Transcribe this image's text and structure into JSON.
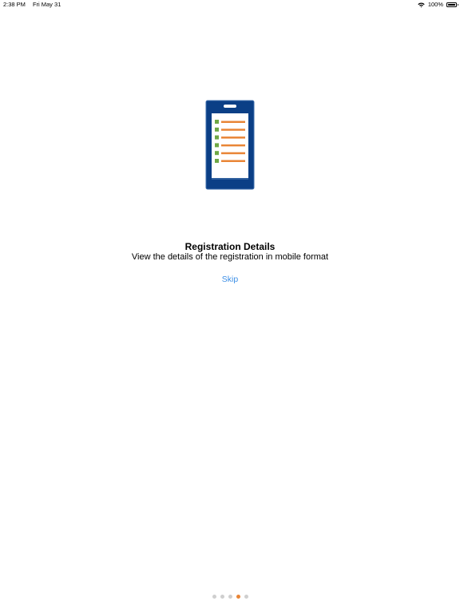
{
  "status_bar": {
    "time": "2:38 PM",
    "date": "Fri May 31",
    "battery_percent": "100%",
    "icons": [
      "wifi-icon",
      "battery-icon"
    ]
  },
  "illustration": {
    "icon": "mobile-registration-checklist-icon",
    "colors": {
      "phone_body": "#0b3f86",
      "screen": "#ffffff",
      "checkbox": "#6ea844",
      "line": "#e98536"
    }
  },
  "onboarding": {
    "title": "Registration Details",
    "subtitle": "View the details of the registration in mobile format",
    "skip_label": "Skip"
  },
  "pager": {
    "page_count": 5,
    "active_index": 3,
    "colors": {
      "inactive": "#cfcfcf",
      "active": "#e98536"
    }
  },
  "colors": {
    "link": "#3d8fe6",
    "background": "#ffffff"
  }
}
